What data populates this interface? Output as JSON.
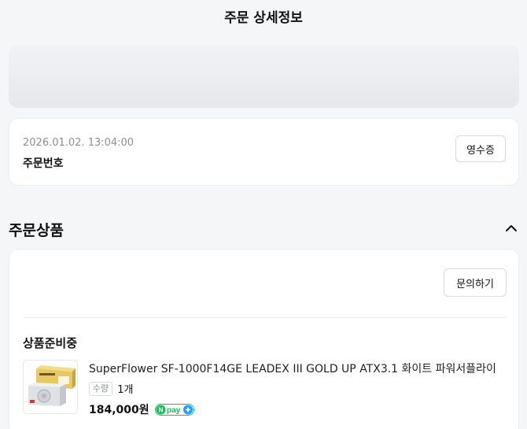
{
  "header": {
    "title": "주문 상세정보"
  },
  "order": {
    "date": "2026.01.02. 13:04:00",
    "label": "주문번호",
    "receipt_button": "영수증"
  },
  "section": {
    "title": "주문상품",
    "toggle_icon": "chevron-up-icon"
  },
  "product_card": {
    "inquiry_button": "문의하기",
    "status": "상품준비중",
    "product": {
      "name": "SuperFlower SF-1000F14GE LEADEX III GOLD UP ATX3.1 화이트 파워서플라이",
      "quantity_label": "수량",
      "quantity_value": "1개",
      "price": "184,000원",
      "pay_badge": "pay"
    }
  },
  "colors": {
    "background": "#f5f6f8",
    "npay_green": "#03c75a",
    "npay_blue": "#1ea1f7"
  }
}
